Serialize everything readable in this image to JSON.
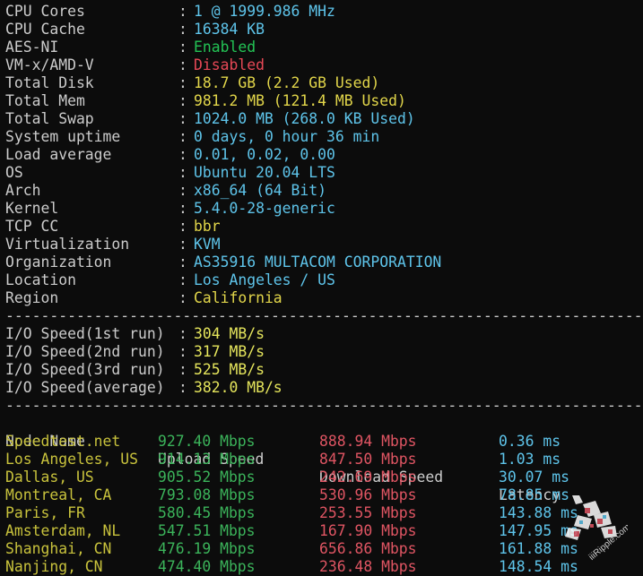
{
  "system_info": [
    {
      "label": "CPU Cores",
      "value": "1 @ 1999.986 MHz",
      "color": "#5ec4ea"
    },
    {
      "label": "CPU Cache",
      "value": "16384 KB",
      "color": "#5ec4ea"
    },
    {
      "label": "AES-NI",
      "value": "Enabled",
      "color": "#23c455"
    },
    {
      "label": "VM-x/AMD-V",
      "value": "Disabled",
      "color": "#e74856"
    },
    {
      "label": "Total Disk",
      "value": "18.7 GB (2.2 GB Used)",
      "color": "#e2d64a"
    },
    {
      "label": "Total Mem",
      "value": "981.2 MB (121.4 MB Used)",
      "color": "#e2d64a"
    },
    {
      "label": "Total Swap",
      "value": "1024.0 MB (268.0 KB Used)",
      "color": "#5ec4ea"
    },
    {
      "label": "System uptime",
      "value": "0 days, 0 hour 36 min",
      "color": "#5ec4ea"
    },
    {
      "label": "Load average",
      "value": "0.01, 0.02, 0.00",
      "color": "#5ec4ea"
    },
    {
      "label": "OS",
      "value": "Ubuntu 20.04 LTS",
      "color": "#5ec4ea"
    },
    {
      "label": "Arch",
      "value": "x86_64 (64 Bit)",
      "color": "#5ec4ea"
    },
    {
      "label": "Kernel",
      "value": "5.4.0-28-generic",
      "color": "#5ec4ea"
    },
    {
      "label": "TCP CC",
      "value": "bbr",
      "color": "#e2d64a"
    },
    {
      "label": "Virtualization",
      "value": "KVM",
      "color": "#5ec4ea"
    },
    {
      "label": "Organization",
      "value": "AS35916 MULTACOM CORPORATION",
      "color": "#5ec4ea"
    },
    {
      "label": "Location",
      "value": "Los Angeles / US",
      "color": "#5ec4ea"
    },
    {
      "label": "Region",
      "value": "California",
      "color": "#e2d64a"
    }
  ],
  "separator": "-------------------------------------------------------------------------------",
  "io_speed": [
    {
      "label": "I/O Speed(1st run)",
      "value": "304 MB/s"
    },
    {
      "label": "I/O Speed(2nd run)",
      "value": "317 MB/s"
    },
    {
      "label": "I/O Speed(3rd run)",
      "value": "525 MB/s"
    },
    {
      "label": "I/O Speed(average)",
      "value": "382.0 MB/s"
    }
  ],
  "speedtest": {
    "headers": [
      "Node Name",
      "Upload Speed",
      "Download Speed",
      "Latency"
    ],
    "rows": [
      {
        "node": "Speedtest.net",
        "upload": "927.40 Mbps",
        "download": "888.94 Mbps",
        "latency": "0.36 ms"
      },
      {
        "node": "Los Angeles, US",
        "upload": "914.13 Mbps",
        "download": "847.50 Mbps",
        "latency": "1.03 ms"
      },
      {
        "node": "Dallas, US",
        "upload": "905.52 Mbps",
        "download": "242.69 Mbps",
        "latency": "30.07 ms"
      },
      {
        "node": "Montreal, CA",
        "upload": "793.08 Mbps",
        "download": "530.96 Mbps",
        "latency": "78.85 ms"
      },
      {
        "node": "Paris, FR",
        "upload": "580.45 Mbps",
        "download": "253.55 Mbps",
        "latency": "143.88 ms"
      },
      {
        "node": "Amsterdam, NL",
        "upload": "547.51 Mbps",
        "download": "167.90 Mbps",
        "latency": "147.95 ms"
      },
      {
        "node": "Shanghai, CN",
        "upload": "476.19 Mbps",
        "download": "656.86 Mbps",
        "latency": "161.88 ms"
      },
      {
        "node": "Nanjing, CN",
        "upload": "474.40 Mbps",
        "download": "236.48 Mbps",
        "latency": "148.54 ms"
      }
    ]
  },
  "watermark": {
    "text": "iiiRipple.com",
    "icon": "ripple-logo-icon"
  }
}
